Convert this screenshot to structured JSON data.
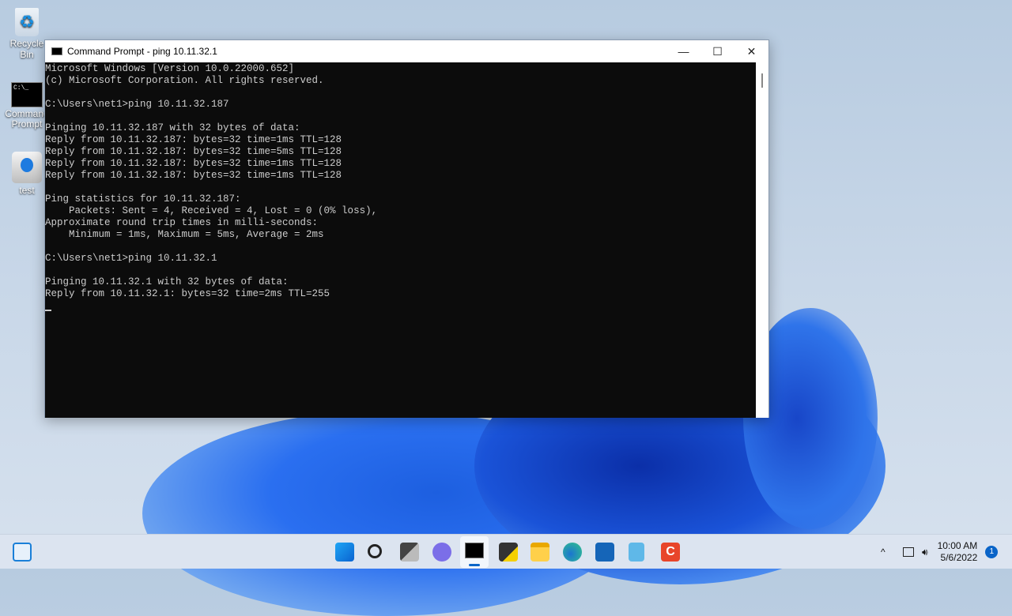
{
  "desktop": {
    "icons": [
      {
        "label": "Recycle Bin"
      },
      {
        "label": "Command Prompt"
      },
      {
        "label": "test"
      }
    ]
  },
  "window": {
    "title": "Command Prompt - ping  10.11.32.1",
    "minimize": "—",
    "maximize": "☐",
    "close": "✕"
  },
  "console": {
    "lines": [
      "Microsoft Windows [Version 10.0.22000.652]",
      "(c) Microsoft Corporation. All rights reserved.",
      "",
      "C:\\Users\\net1>ping 10.11.32.187",
      "",
      "Pinging 10.11.32.187 with 32 bytes of data:",
      "Reply from 10.11.32.187: bytes=32 time=1ms TTL=128",
      "Reply from 10.11.32.187: bytes=32 time=5ms TTL=128",
      "Reply from 10.11.32.187: bytes=32 time=1ms TTL=128",
      "Reply from 10.11.32.187: bytes=32 time=1ms TTL=128",
      "",
      "Ping statistics for 10.11.32.187:",
      "    Packets: Sent = 4, Received = 4, Lost = 0 (0% loss),",
      "Approximate round trip times in milli-seconds:",
      "    Minimum = 1ms, Maximum = 5ms, Average = 2ms",
      "",
      "C:\\Users\\net1>ping 10.11.32.1",
      "",
      "Pinging 10.11.32.1 with 32 bytes of data:",
      "Reply from 10.11.32.1: bytes=32 time=2ms TTL=255"
    ]
  },
  "taskbar": {
    "apps": [
      "start",
      "search",
      "task-view",
      "teams-chat",
      "command-prompt",
      "sticky-notes",
      "file-explorer",
      "edge",
      "store",
      "notepad",
      "app-c"
    ]
  },
  "tray": {
    "time": "10:00 AM",
    "date": "5/6/2022",
    "notification_count": "1",
    "chevron": "^"
  }
}
